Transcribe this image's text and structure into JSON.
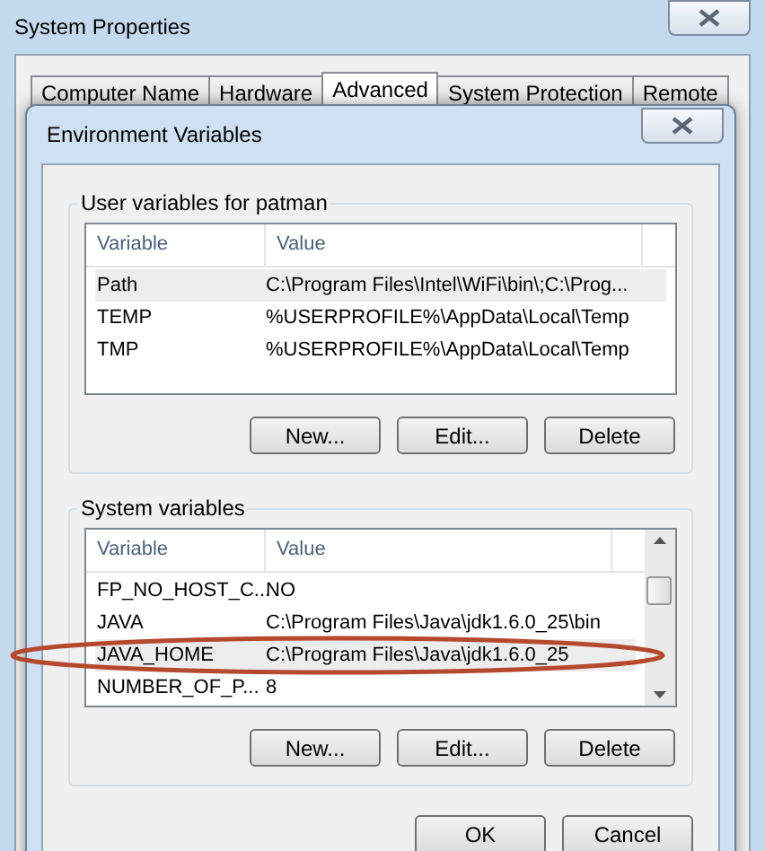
{
  "window": {
    "title": "System Properties"
  },
  "tabs": [
    {
      "label": "Computer Name",
      "selected": false
    },
    {
      "label": "Hardware",
      "selected": false
    },
    {
      "label": "Advanced",
      "selected": true
    },
    {
      "label": "System Protection",
      "selected": false
    },
    {
      "label": "Remote",
      "selected": false
    }
  ],
  "dialog": {
    "title": "Environment Variables",
    "groups": [
      {
        "title": "User variables for patman",
        "columns": [
          "Variable",
          "Value"
        ],
        "scrollbar": false,
        "rows": [
          {
            "name": "Path",
            "value": "C:\\Program Files\\Intel\\WiFi\\bin\\;C:\\Prog...",
            "selected": true
          },
          {
            "name": "TEMP",
            "value": "%USERPROFILE%\\AppData\\Local\\Temp",
            "selected": false
          },
          {
            "name": "TMP",
            "value": "%USERPROFILE%\\AppData\\Local\\Temp",
            "selected": false
          }
        ],
        "buttons": [
          "New...",
          "Edit...",
          "Delete"
        ]
      },
      {
        "title": "System variables",
        "columns": [
          "Variable",
          "Value"
        ],
        "scrollbar": true,
        "rows": [
          {
            "name": "FP_NO_HOST_C...",
            "value": "NO",
            "selected": false
          },
          {
            "name": "JAVA",
            "value": "C:\\Program Files\\Java\\jdk1.6.0_25\\bin",
            "selected": false
          },
          {
            "name": "JAVA_HOME",
            "value": "C:\\Program Files\\Java\\jdk1.6.0_25",
            "selected": true
          },
          {
            "name": "NUMBER_OF_P...",
            "value": "8",
            "selected": false
          }
        ],
        "buttons": [
          "New...",
          "Edit...",
          "Delete"
        ]
      }
    ],
    "buttons": [
      "OK",
      "Cancel"
    ]
  }
}
